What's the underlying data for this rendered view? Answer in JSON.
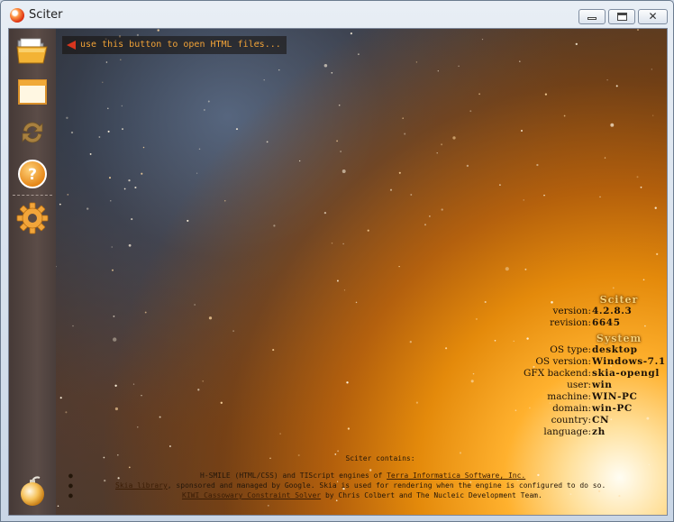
{
  "window": {
    "title": "Sciter"
  },
  "sidebar": {
    "tools": [
      {
        "name": "open",
        "icon": "folder-open-icon"
      },
      {
        "name": "blank",
        "icon": "blank-window-icon"
      },
      {
        "name": "reload",
        "icon": "reload-icon"
      },
      {
        "name": "help",
        "icon": "help-icon",
        "glyph": "?"
      },
      {
        "name": "settings",
        "icon": "gear-icon"
      },
      {
        "name": "inspector",
        "icon": "inspector-bomb-icon"
      }
    ]
  },
  "hint": {
    "text": "use this button to open HTML files..."
  },
  "sciter": {
    "title": "Sciter",
    "rows": [
      {
        "key": "version:",
        "value": "4.2.8.3"
      },
      {
        "key": "revision:",
        "value": "6645"
      }
    ]
  },
  "system": {
    "title": "System",
    "rows": [
      {
        "key": "OS type:",
        "value": "desktop"
      },
      {
        "key": "OS version:",
        "value": "Windows-7.1"
      },
      {
        "key": "GFX backend:",
        "value": "skia-opengl"
      },
      {
        "key": "user:",
        "value": "win"
      },
      {
        "key": "machine:",
        "value": "WIN-PC"
      },
      {
        "key": "domain:",
        "value": "win-PC"
      },
      {
        "key": "country:",
        "value": "CN"
      },
      {
        "key": "language:",
        "value": "zh"
      }
    ]
  },
  "contains": {
    "title": "Sciter contains:",
    "line1": {
      "prefix": "H-SMILE (HTML/CSS) and TIScript engines of ",
      "link": "Terra Informatica Software, Inc."
    },
    "line2": {
      "link": "Skia library",
      "suffix": ", sponsored and managed by Google. Skia is used for rendering when the engine is configured to do so."
    },
    "line3": {
      "link": "KIWI Cassowary Constraint Solver",
      "suffix": " by Chris Colbert and The Nucleic Development Team."
    }
  },
  "colors": {
    "hint_text": "#f1a237",
    "hint_arrow": "#d8351e",
    "section_title": "#f7d27a",
    "sidebar": "#55463f"
  }
}
